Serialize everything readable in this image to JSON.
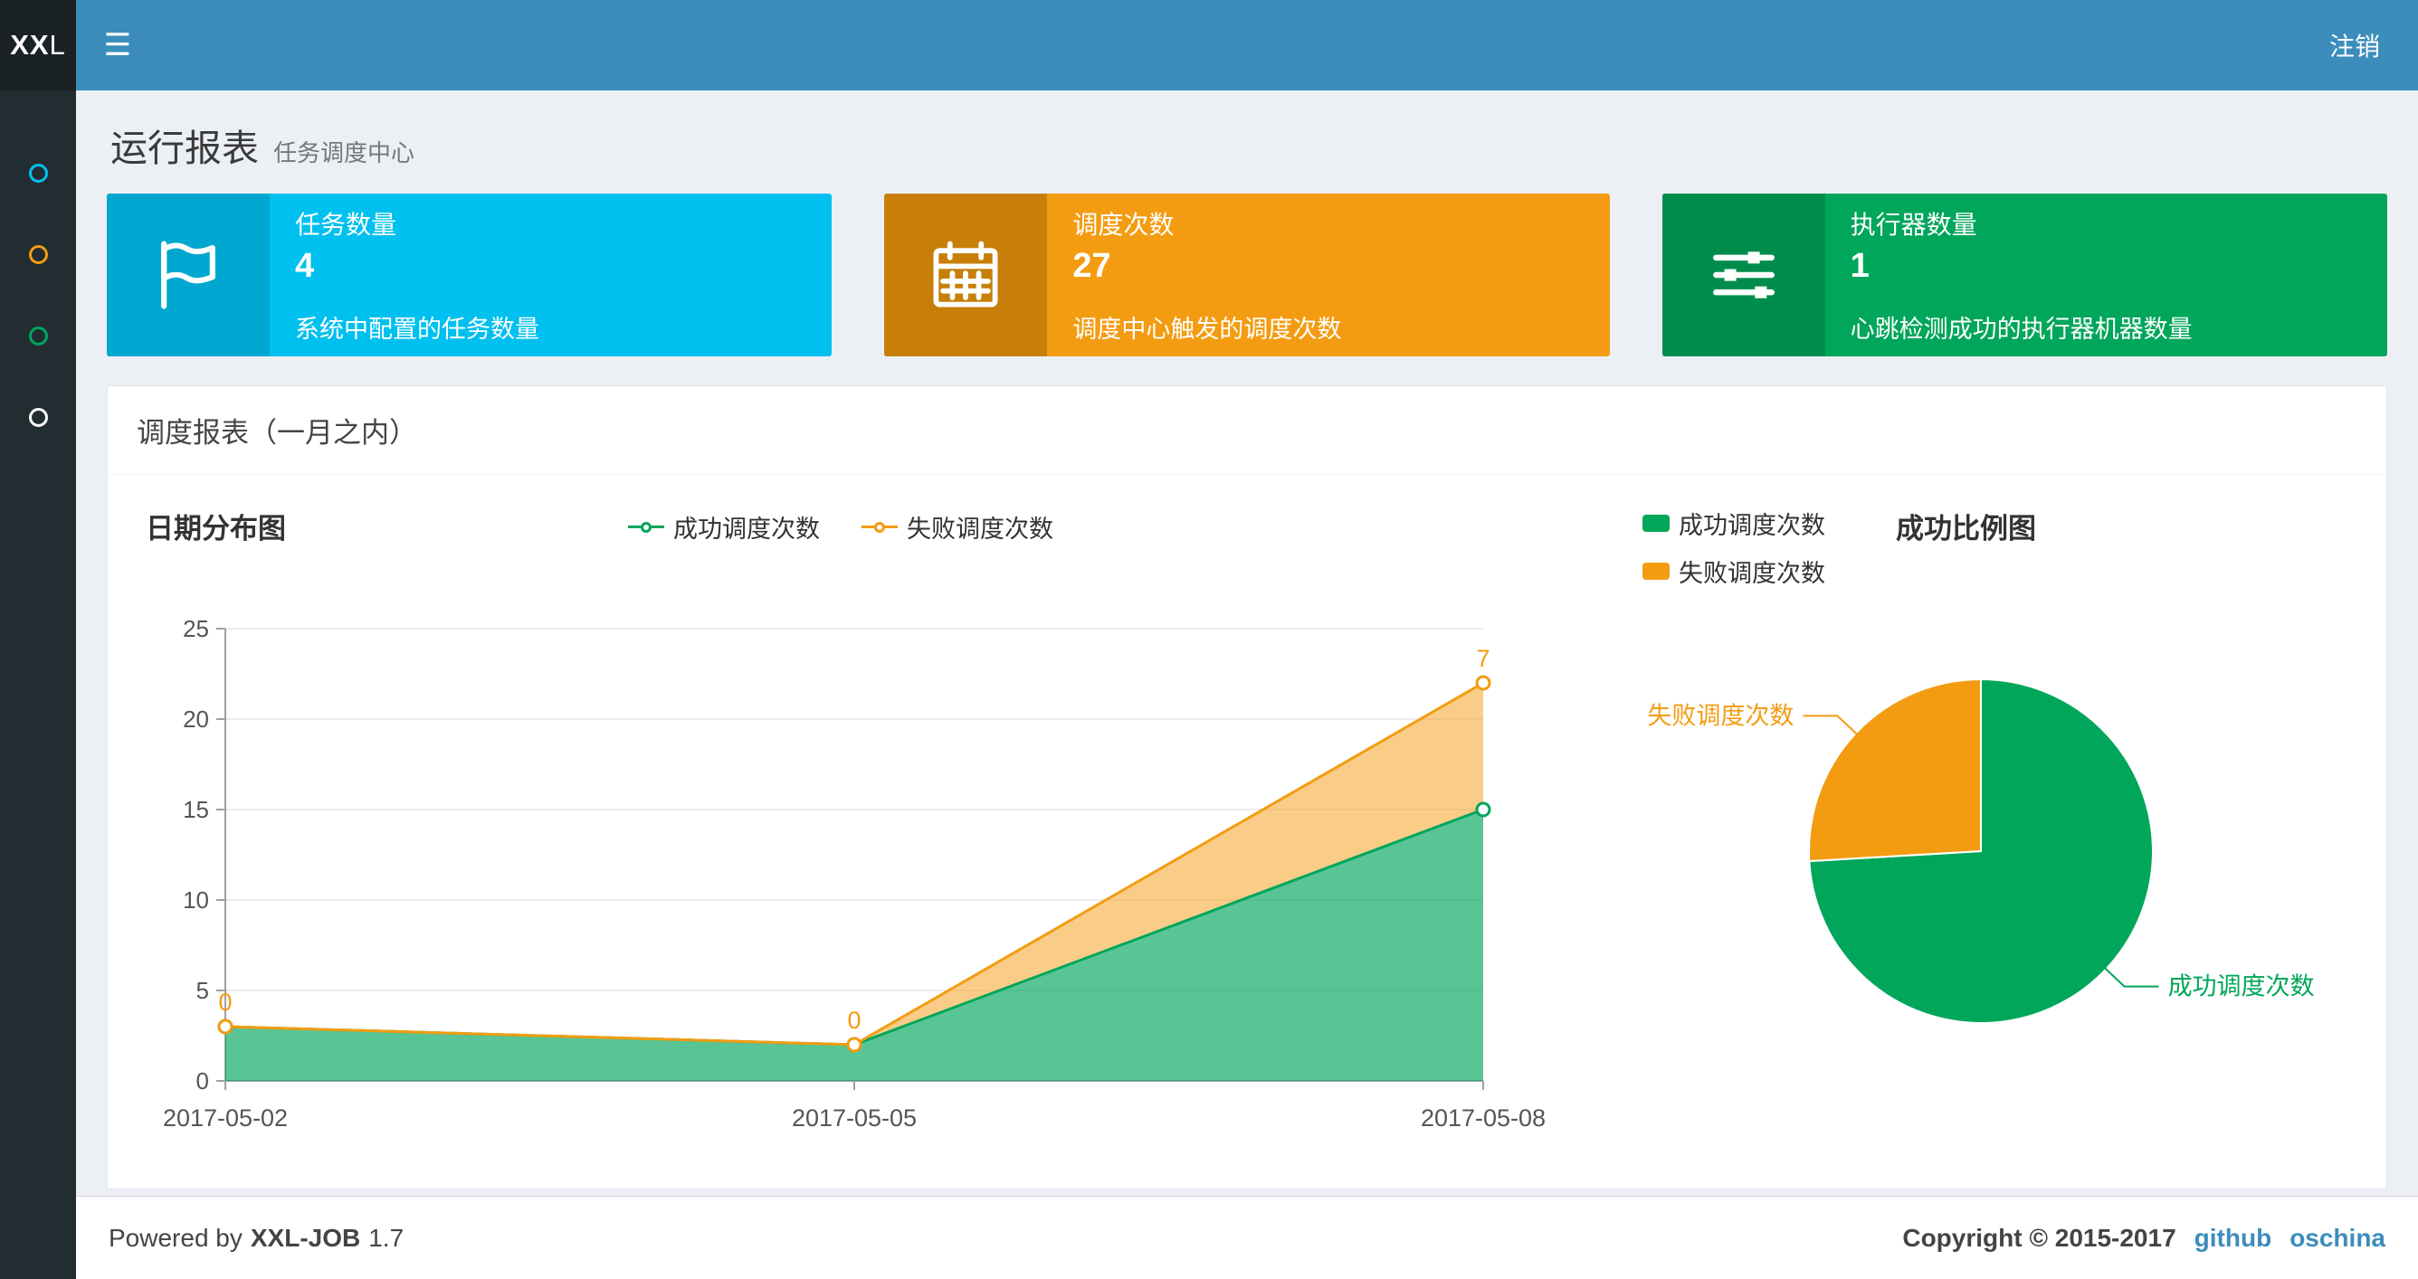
{
  "theme": {
    "navbar": "#3c8dbc",
    "sidebar": "#222d32",
    "link_blue": "#3c8dbc"
  },
  "header": {
    "logo_bold": "XX",
    "logo_rest": "L",
    "logout": "注销"
  },
  "sidebar": {
    "items": [
      {
        "color": "#00c0ef"
      },
      {
        "color": "#f39c12"
      },
      {
        "color": "#00a65a"
      },
      {
        "color": "#ffffff"
      }
    ]
  },
  "page": {
    "title": "运行报表",
    "subtitle": "任务调度中心"
  },
  "info_boxes": [
    {
      "icon": "flag-icon",
      "label": "任务数量",
      "value": "4",
      "desc": "系统中配置的任务数量",
      "bg": "#00c0ef",
      "icon_bg": "#00a7d0"
    },
    {
      "icon": "calendar-icon",
      "label": "调度次数",
      "value": "27",
      "desc": "调度中心触发的调度次数",
      "bg": "#f39c12",
      "icon_bg": "#c87f0a"
    },
    {
      "icon": "sliders-icon",
      "label": "执行器数量",
      "value": "1",
      "desc": "心跳检测成功的执行器机器数量",
      "bg": "#00a65a",
      "icon_bg": "#008d4c"
    }
  ],
  "panel": {
    "title": "调度报表（一月之内）"
  },
  "chart_data": [
    {
      "type": "area",
      "title": "日期分布图",
      "stacked": true,
      "grid": true,
      "legend_position": "top-center",
      "x": [
        "2017-05-02",
        "2017-05-05",
        "2017-05-08"
      ],
      "ylim": [
        0,
        25
      ],
      "yticks": [
        0,
        5,
        10,
        15,
        20,
        25
      ],
      "series": [
        {
          "name": "成功调度次数",
          "color": "#00a65a",
          "values": [
            3,
            2,
            15
          ],
          "area_opacity": 0.65,
          "show_point_labels": false
        },
        {
          "name": "失败调度次数",
          "color": "#f39c12",
          "values": [
            0,
            0,
            7
          ],
          "area_opacity": 0.5,
          "show_point_labels": true
        }
      ]
    },
    {
      "type": "pie",
      "title": "成功比例图",
      "legend_position": "top-left",
      "slices": [
        {
          "name": "成功调度次数",
          "color": "#00a65a",
          "value": 20
        },
        {
          "name": "失败调度次数",
          "color": "#f39c12",
          "value": 7
        }
      ]
    }
  ],
  "footer": {
    "powered_prefix": "Powered by",
    "brand": "XXL-JOB",
    "version": "1.7",
    "copyright": "Copyright © 2015-2017",
    "links": [
      "github",
      "oschina"
    ]
  }
}
